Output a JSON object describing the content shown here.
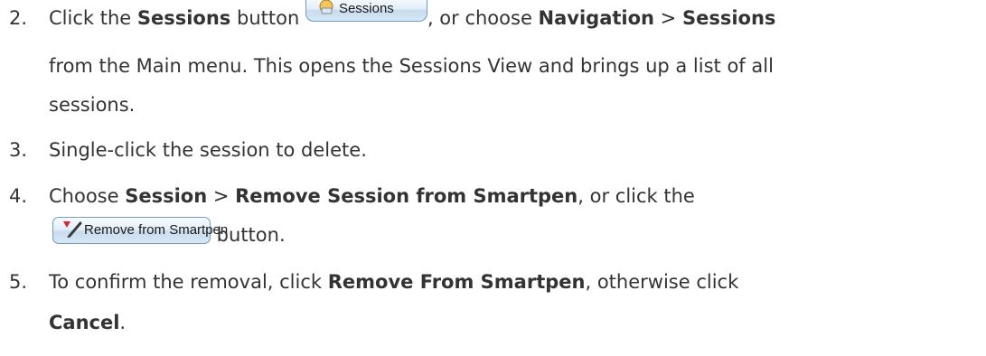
{
  "steps": [
    {
      "number": "2.",
      "text_click": "Click the ",
      "bold_sessions": "Sessions",
      "text_button": " button ",
      "sessions_button_label": "Sessions",
      "text_or_choose": ", or choose ",
      "bold_navigation": "Navigation",
      "separator": " > ",
      "bold_sessions_menu": "Sessions",
      "line2": "from the Main menu. This opens the Sessions View and brings up a list of all",
      "line3": "sessions."
    },
    {
      "number": "3.",
      "text": "Single-click the session to delete."
    },
    {
      "number": "4.",
      "text_choose": "Choose ",
      "bold_session": "Session",
      "separator": " > ",
      "bold_remove": "Remove Session from Smartpen",
      "text_or_click": ", or click the",
      "remove_button_label": "Remove from Smartpen",
      "text_button": " button."
    },
    {
      "number": "5.",
      "text_confirm": "To confirm the removal, click ",
      "bold_remove_from": "Remove From Smartpen",
      "text_otherwise": ", otherwise click",
      "bold_cancel": "Cancel",
      "period": "."
    }
  ]
}
